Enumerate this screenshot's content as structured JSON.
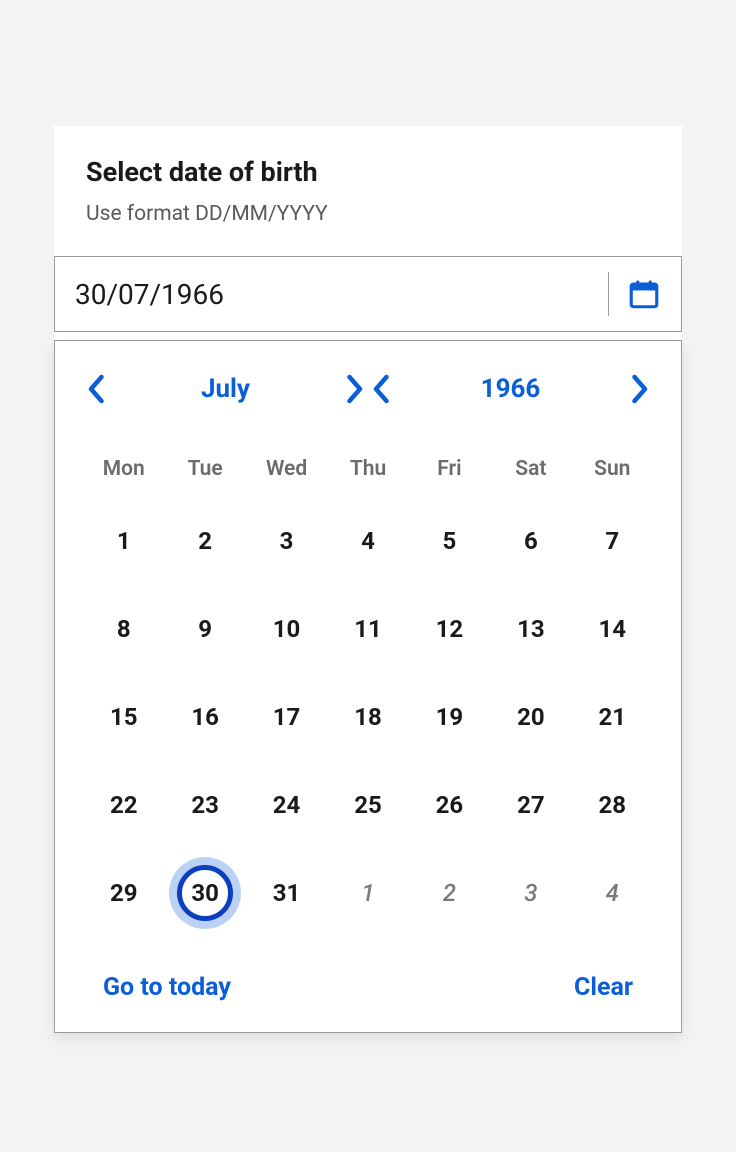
{
  "header": {
    "title": "Select date of birth",
    "hint": "Use format DD/MM/YYYY"
  },
  "input": {
    "value": "30/07/1966"
  },
  "calendar": {
    "month_label": "July",
    "year_label": "1966",
    "weekdays": [
      "Mon",
      "Tue",
      "Wed",
      "Thu",
      "Fri",
      "Sat",
      "Sun"
    ],
    "weeks": [
      [
        {
          "d": "1"
        },
        {
          "d": "2"
        },
        {
          "d": "3"
        },
        {
          "d": "4"
        },
        {
          "d": "5"
        },
        {
          "d": "6"
        },
        {
          "d": "7"
        }
      ],
      [
        {
          "d": "8"
        },
        {
          "d": "9"
        },
        {
          "d": "10"
        },
        {
          "d": "11"
        },
        {
          "d": "12"
        },
        {
          "d": "13"
        },
        {
          "d": "14"
        }
      ],
      [
        {
          "d": "15"
        },
        {
          "d": "16"
        },
        {
          "d": "17"
        },
        {
          "d": "18"
        },
        {
          "d": "19"
        },
        {
          "d": "20"
        },
        {
          "d": "21"
        }
      ],
      [
        {
          "d": "22"
        },
        {
          "d": "23"
        },
        {
          "d": "24"
        },
        {
          "d": "25"
        },
        {
          "d": "26"
        },
        {
          "d": "27"
        },
        {
          "d": "28"
        }
      ],
      [
        {
          "d": "29"
        },
        {
          "d": "30",
          "selected": true
        },
        {
          "d": "31"
        },
        {
          "d": "1",
          "other": true
        },
        {
          "d": "2",
          "other": true
        },
        {
          "d": "3",
          "other": true
        },
        {
          "d": "4",
          "other": true
        }
      ]
    ],
    "footer": {
      "today_label": "Go to today",
      "clear_label": "Clear"
    }
  },
  "colors": {
    "accent": "#0b5fd6"
  }
}
